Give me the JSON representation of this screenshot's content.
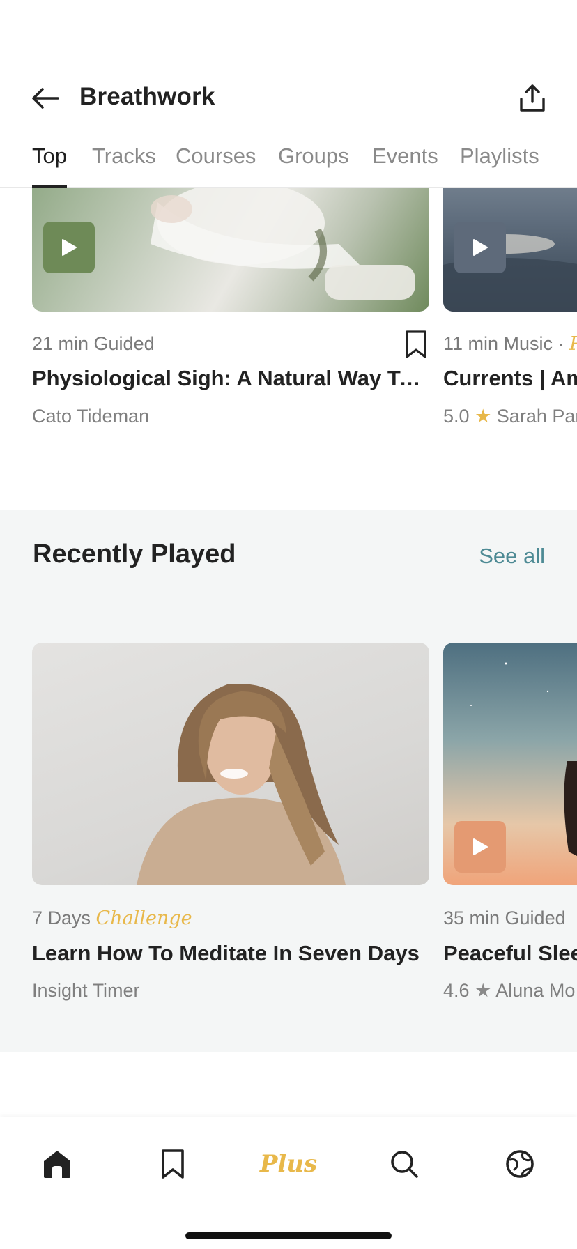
{
  "header": {
    "title": "Breathwork",
    "back_icon": "arrow-left-icon",
    "share_icon": "share-icon"
  },
  "tabs": [
    {
      "label": "Top",
      "active": true
    },
    {
      "label": "Tracks",
      "active": false
    },
    {
      "label": "Courses",
      "active": false
    },
    {
      "label": "Groups",
      "active": false
    },
    {
      "label": "Events",
      "active": false
    },
    {
      "label": "Playlists",
      "active": false
    }
  ],
  "top_cards": [
    {
      "meta": "21 min Guided",
      "title": "Physiological Sigh: A Natural Way To Re...",
      "author": "Cato Tideman"
    },
    {
      "meta": "11 min Music · ",
      "meta_accent": "P",
      "title": "Currents | Am",
      "rating": "5.0",
      "author": "Sarah Par"
    }
  ],
  "recently_played": {
    "title": "Recently Played",
    "see_all": "See all",
    "cards": [
      {
        "meta": "7 Days ",
        "meta_accent": "Challenge",
        "title": "Learn How To Meditate In Seven Days",
        "author": "Insight Timer"
      },
      {
        "meta": "35 min Guided",
        "title": "Peaceful Sleep",
        "rating": "4.6",
        "author": "Aluna Mo"
      }
    ]
  },
  "bottom_nav": {
    "home_icon": "home-icon",
    "saved_icon": "bookmark-icon",
    "plus_label": "Plus",
    "search_icon": "search-icon",
    "community_icon": "globe-icon"
  },
  "colors": {
    "accent_gold": "#e8b84a",
    "link_teal": "#4d8a94",
    "section_bg": "#f4f6f6"
  }
}
